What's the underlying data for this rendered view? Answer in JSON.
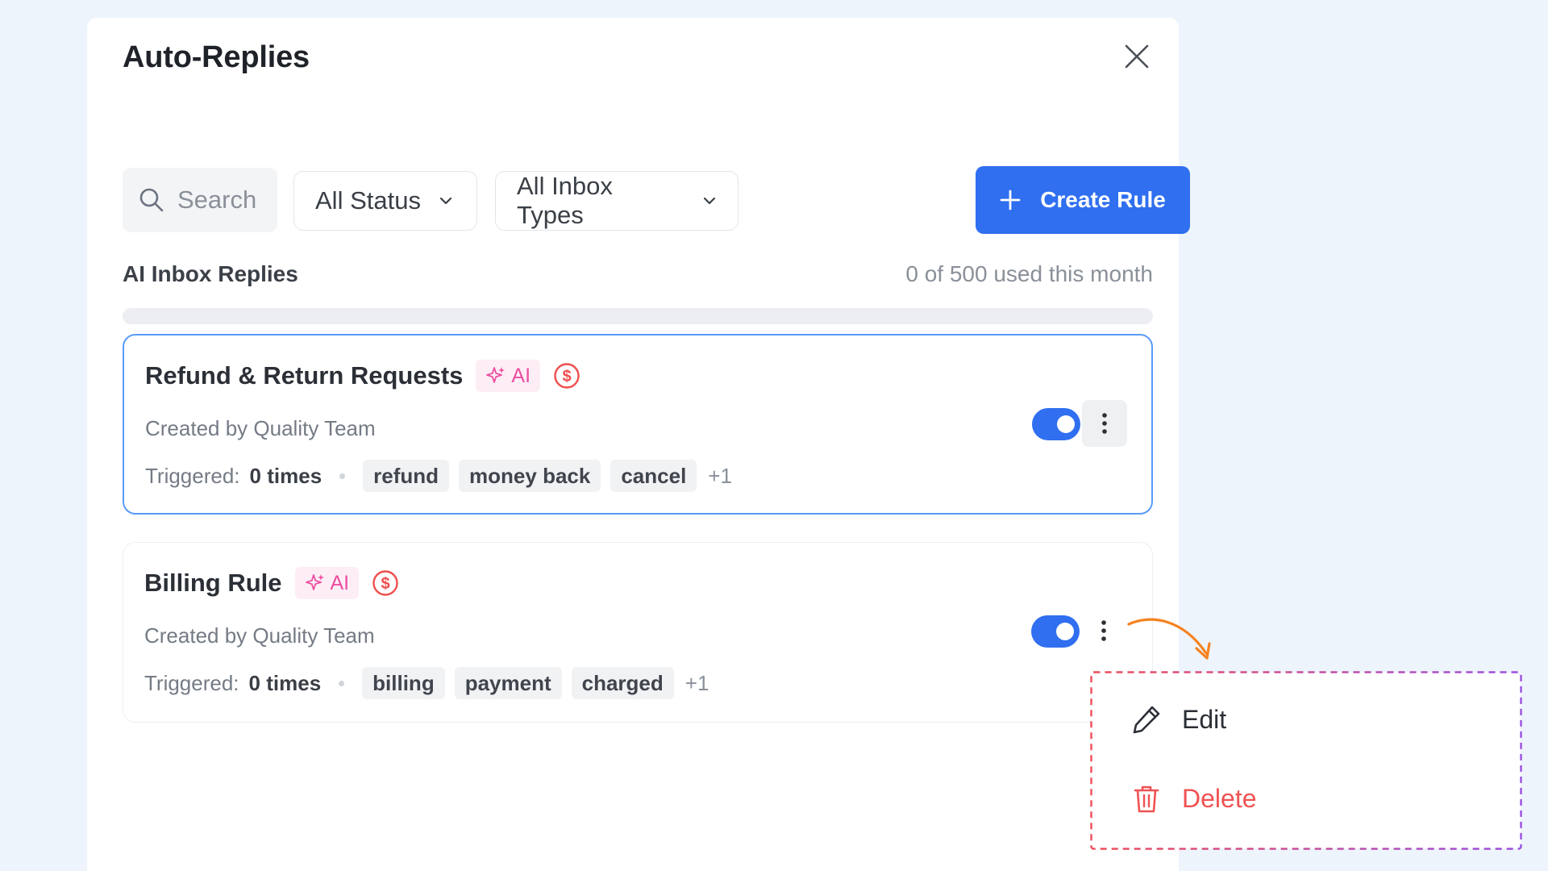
{
  "modal": {
    "title": "Auto-Replies"
  },
  "toolbar": {
    "search_placeholder": "Search",
    "status_filter": "All Status",
    "inbox_filter": "All Inbox Types",
    "create_label": "Create Rule"
  },
  "usage": {
    "title": "AI Inbox Replies",
    "count_text": "0 of 500 used this month",
    "used": 0,
    "limit": 500
  },
  "rules": [
    {
      "name": "Refund & Return Requests",
      "ai_badge": "AI",
      "created_by": "Created by Quality Team",
      "triggered_label": "Triggered:",
      "triggered_count": "0 times",
      "tags": [
        "refund",
        "money back",
        "cancel"
      ],
      "more_tags": "+1",
      "enabled": true
    },
    {
      "name": "Billing Rule",
      "ai_badge": "AI",
      "created_by": "Created by Quality Team",
      "triggered_label": "Triggered:",
      "triggered_count": "0 times",
      "tags": [
        "billing",
        "payment",
        "charged"
      ],
      "more_tags": "+1",
      "enabled": true
    }
  ],
  "context_menu": {
    "edit_label": "Edit",
    "delete_label": "Delete"
  },
  "icons": {
    "close": "close-icon",
    "search": "search-icon",
    "chevron": "chevron-down-icon",
    "plus": "plus-icon",
    "sparkle": "sparkle-icon",
    "dollar": "dollar-circle-icon",
    "kebab": "kebab-menu-icon",
    "edit": "pencil-icon",
    "delete": "trash-icon"
  },
  "colors": {
    "accent": "#2f6ff0",
    "ai_pink": "#ec4ea0",
    "danger": "#f05252",
    "annotation_arrow": "#f5821f"
  }
}
